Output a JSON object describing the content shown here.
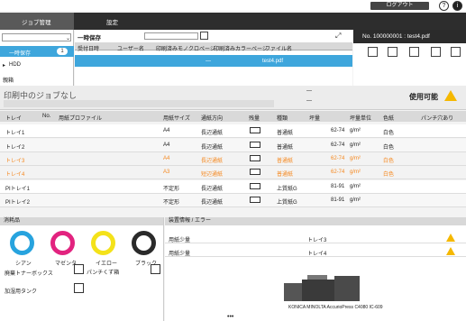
{
  "header": {
    "logout_label": "ログアウト"
  },
  "menu": {
    "items": [
      "ジョブ管理",
      "設定"
    ]
  },
  "left_panel": {
    "search_placeholder": "",
    "tree": [
      {
        "label": "一時保存",
        "count": "1"
      },
      {
        "label": "HDD",
        "count": ""
      },
      {
        "label": "親箱",
        "count": ""
      }
    ]
  },
  "job_list": {
    "title": "一時保存",
    "columns": [
      "受付日時",
      "ユーザー名",
      "印刷済みモノクロページ",
      "印刷済みカラーページ",
      "ファイル名"
    ],
    "rows": [
      {
        "datetime": "",
        "user": "",
        "mono": "",
        "color": "—",
        "filename": "test4.pdf"
      }
    ]
  },
  "detail_panel": {
    "title": "No. 100000001 : test4.pdf"
  },
  "status": {
    "job_text": "印刷中のジョブなし",
    "dash1": "—",
    "dash2": "—",
    "ready_label": "使用可能"
  },
  "trays": {
    "columns": [
      "トレイ",
      "No.",
      "用紙プロファイル",
      "用紙サイズ",
      "通紙方向",
      "残量",
      "種類",
      "坪量",
      "坪量単位",
      "色紙",
      "パンチ穴あり"
    ],
    "rows": [
      {
        "tray": "トレイ1",
        "size": "A4",
        "dir": "長辺通紙",
        "type": "普通紙",
        "weight": "62-74",
        "unit": "g/m²",
        "color": "白色",
        "state": "normal"
      },
      {
        "tray": "トレイ2",
        "size": "A4",
        "dir": "長辺通紙",
        "type": "普通紙",
        "weight": "62-74",
        "unit": "g/m²",
        "color": "白色",
        "state": "alt"
      },
      {
        "tray": "トレイ3",
        "size": "A4",
        "dir": "長辺通紙",
        "type": "普通紙",
        "weight": "62-74",
        "unit": "g/m²",
        "color": "白色",
        "state": "orange"
      },
      {
        "tray": "トレイ4",
        "size": "A3",
        "dir": "短辺通紙",
        "type": "普通紙",
        "weight": "62-74",
        "unit": "g/m²",
        "color": "白色",
        "state": "orange"
      },
      {
        "tray": "PIトレイ1",
        "size": "不定形",
        "dir": "長辺通紙",
        "type": "上質紙G",
        "weight": "81-91",
        "unit": "g/m²",
        "color": "",
        "state": "normal"
      },
      {
        "tray": "PIトレイ2",
        "size": "不定形",
        "dir": "長辺通紙",
        "type": "上質紙G",
        "weight": "81-91",
        "unit": "g/m²",
        "color": "",
        "state": "alt"
      }
    ]
  },
  "consumables": {
    "title": "消耗品",
    "toners": [
      {
        "label": "シアン",
        "color": "#27a3de"
      },
      {
        "label": "マゼンタ",
        "color": "#e2237f"
      },
      {
        "label": "イエロー",
        "color": "#f4e21a"
      },
      {
        "label": "ブラック",
        "color": "#2a2a2a"
      }
    ],
    "waste_box_label": "廃棄トナーボックス",
    "punch_label": "パンチくず箱",
    "staple_label": "加湿用タンク"
  },
  "device_info": {
    "title": "装置情報 / エラー",
    "rows": [
      {
        "message": "用紙少量",
        "location": "トレイ3"
      },
      {
        "message": "用紙少量",
        "location": "トレイ4"
      }
    ],
    "model_label": "KONICA MINOLTA AccurioPress C4080 IC-609"
  },
  "colors": {
    "accent": "#3ea6dc",
    "warning": "#f5b800",
    "orange_text": "#f5881f",
    "dark_bar": "#2d2d2d"
  }
}
